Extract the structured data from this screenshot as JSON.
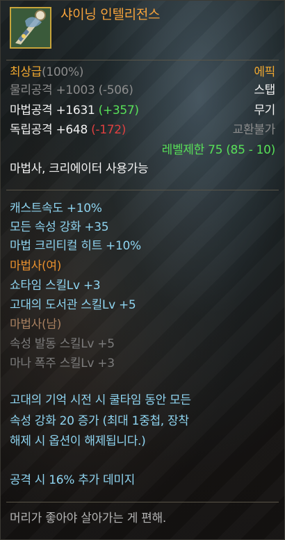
{
  "item": {
    "name": "샤이닝 인텔리전스",
    "grade": "최상급",
    "grade_pct": "(100%)",
    "rarity": "에픽",
    "type1": "스탭",
    "type2": "무기",
    "trade": "교환불가",
    "icon": "staff-item-icon"
  },
  "stats": {
    "physical_label": "물리공격 +1003",
    "physical_diff": "(-506)",
    "magic_label": "마법공격 +1631",
    "magic_diff": "(+357)",
    "independent_label": "독립공격 +648",
    "independent_diff": "(-172)"
  },
  "level_limit": "레벨제한 75 (85 - 10)",
  "usable": "마법사, 크리에이터 사용가능",
  "options": [
    "캐스트속도 +10%",
    "모든 속성 강화 +35",
    "마법 크리티컬 히트 +10%"
  ],
  "class_female": {
    "title": "마법사(여)",
    "skills": [
      "쇼타임 스킬Lv +3",
      "고대의 도서관 스킬Lv +5"
    ]
  },
  "class_male": {
    "title": "마법사(남)",
    "skills": [
      "속성 발동 스킬Lv +5",
      "마나 폭주 스킬Lv +3"
    ]
  },
  "special": [
    "고대의 기억 시전 시 쿨타임 동안 모든",
    "속성 강화 20 증가 (최대 1중첩, 장착",
    "해제 시 옵션이 해제됩니다.)"
  ],
  "bonus": "공격 시 16% 추가 데미지",
  "flavor": "머리가 좋아야 살아가는 게 편해.",
  "colors": {
    "name": "#f4a23c",
    "grade": "#f0a830",
    "level_req": "#58e058",
    "option": "#8ed4f0",
    "female_class": "#e8902e",
    "male_class_inactive": "#a88060",
    "negative": "#e04040",
    "positive": "#58e058"
  }
}
